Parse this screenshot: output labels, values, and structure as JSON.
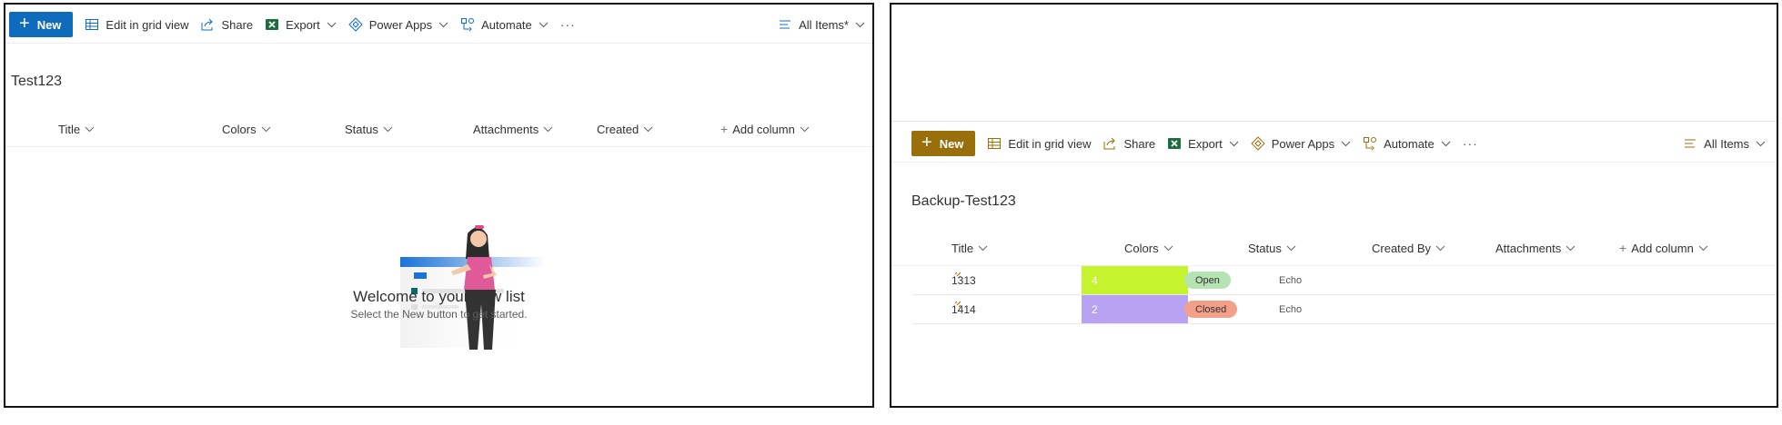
{
  "left": {
    "toolbar": {
      "new_label": "New",
      "edit_grid_label": "Edit in grid view",
      "share_label": "Share",
      "export_label": "Export",
      "power_apps_label": "Power Apps",
      "automate_label": "Automate",
      "more_label": "···",
      "view_label": "All Items*"
    },
    "list_title": "Test123",
    "columns": [
      "Title",
      "Colors",
      "Status",
      "Attachments",
      "Created",
      "Add column"
    ],
    "empty_state": {
      "heading": "Welcome to your new list",
      "subtext": "Select the New button to get started."
    }
  },
  "right": {
    "toolbar": {
      "new_label": "New",
      "edit_grid_label": "Edit in grid view",
      "share_label": "Share",
      "export_label": "Export",
      "power_apps_label": "Power Apps",
      "automate_label": "Automate",
      "more_label": "···",
      "view_label": "All Items"
    },
    "list_title": "Backup-Test123",
    "columns": [
      "Title",
      "Colors",
      "Status",
      "Created By",
      "Attachments",
      "Add column"
    ],
    "rows": [
      {
        "title": "1313",
        "colors": "4",
        "color_bg": "#c5f32e",
        "status": "Open",
        "status_bg": "#b5e3b1",
        "created_by": "Echo"
      },
      {
        "title": "1414",
        "colors": "2",
        "color_bg": "#b8a3f2",
        "status": "Closed",
        "status_bg": "#f3a089",
        "created_by": "Echo"
      }
    ]
  },
  "colors": {
    "accent_blue": "#0f6cbd",
    "accent_gold": "#986f0b",
    "excel_green": "#1d6f42"
  },
  "icons": {
    "new": "plus-icon",
    "edit_grid": "grid-icon",
    "share": "share-icon",
    "export": "excel-icon",
    "power_apps": "power-apps-icon",
    "automate": "automate-icon",
    "view": "view-lines-icon",
    "add_column": "plus-icon",
    "sort": "chevron-down-icon"
  }
}
